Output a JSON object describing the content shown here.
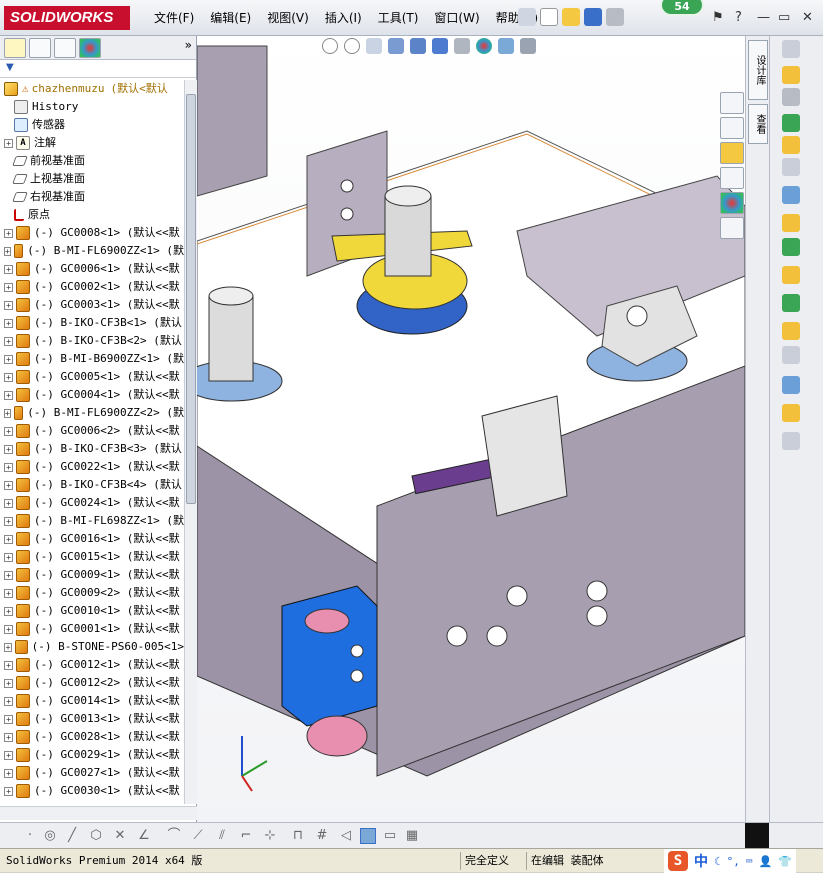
{
  "app": {
    "logo_text": "SOLIDWORKS",
    "menu": [
      "文件(F)",
      "编辑(E)",
      "视图(V)",
      "插入(I)",
      "工具(T)",
      "窗口(W)",
      "帮助(H)"
    ],
    "badge_count": "54"
  },
  "feature_tree": {
    "root": {
      "name": "chazhenmuzu",
      "config": "(默认<默认"
    },
    "fixed_items": [
      {
        "label": "History",
        "icon": "history-icon"
      },
      {
        "label": "传感器",
        "icon": "sensor-icon"
      },
      {
        "label": "注解",
        "icon": "annotation-icon"
      },
      {
        "label": "前视基准面",
        "icon": "plane-icon"
      },
      {
        "label": "上视基准面",
        "icon": "plane-icon"
      },
      {
        "label": "右视基准面",
        "icon": "plane-icon"
      },
      {
        "label": "原点",
        "icon": "origin-icon"
      }
    ],
    "components": [
      "(-) GC0008<1> (默认<<默",
      "(-) B-MI-FL6900ZZ<1> (默",
      "(-) GC0006<1> (默认<<默",
      "(-) GC0002<1> (默认<<默",
      "(-) GC0003<1> (默认<<默",
      "(-) B-IKO-CF3B<1> (默认",
      "(-) B-IKO-CF3B<2> (默认",
      "(-) B-MI-B6900ZZ<1> (默",
      "(-) GC0005<1> (默认<<默",
      "(-) GC0004<1> (默认<<默",
      "(-) B-MI-FL6900ZZ<2> (默",
      "(-) GC0006<2> (默认<<默",
      "(-) B-IKO-CF3B<3> (默认",
      "(-) GC0022<1> (默认<<默",
      "(-) B-IKO-CF3B<4> (默认",
      "(-) GC0024<1> (默认<<默",
      "(-) B-MI-FL698ZZ<1> (默",
      "(-) GC0016<1> (默认<<默",
      "(-) GC0015<1> (默认<<默",
      "(-) GC0009<1> (默认<<默",
      "(-) GC0009<2> (默认<<默",
      "(-) GC0010<1> (默认<<默",
      "(-) GC0001<1> (默认<<默",
      "(-) B-STONE-PS60-005<1>",
      "(-) GC0012<1> (默认<<默",
      "(-) GC0012<2> (默认<<默",
      "(-) GC0014<1> (默认<<默",
      "(-) GC0013<1> (默认<<默",
      "(-) GC0028<1> (默认<<默",
      "(-) GC0029<1> (默认<<默",
      "(-) GC0027<1> (默认<<默",
      "(-) GC0030<1> (默认<<默"
    ]
  },
  "right_tabs": [
    "设计库",
    "查看"
  ],
  "status": {
    "product": "SolidWorks Premium 2014 x64 版",
    "definition": "完全定义",
    "mode": "在编辑 装配体",
    "ime_logo": "S",
    "ime_lang": "中"
  },
  "colors": {
    "brand_red": "#c8102e",
    "part_yellow": "#f3c03b",
    "model_gray": "#9c93a6",
    "blue_block": "#1f6ee0",
    "pink_part": "#e88fb0"
  }
}
